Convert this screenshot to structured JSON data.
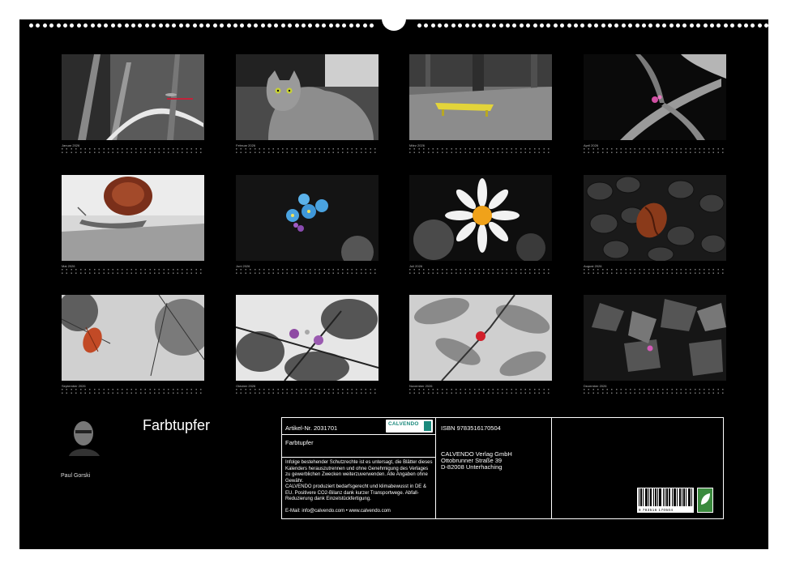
{
  "calendar": {
    "title": "Farbtupfer",
    "author": "Paul Gorski"
  },
  "months": [
    {
      "label": "Januar",
      "year": "2026",
      "icon": "dragonfly-photo"
    },
    {
      "label": "Februar",
      "year": "2026",
      "icon": "cat-photo"
    },
    {
      "label": "März",
      "year": "2026",
      "icon": "yellow-bench-photo"
    },
    {
      "label": "April",
      "year": "2026",
      "icon": "pink-flower-photo"
    },
    {
      "label": "Mai",
      "year": "2026",
      "icon": "snail-photo"
    },
    {
      "label": "Juni",
      "year": "2026",
      "icon": "forget-me-not-photo"
    },
    {
      "label": "Juli",
      "year": "2026",
      "icon": "daisy-photo"
    },
    {
      "label": "August",
      "year": "2026",
      "icon": "coffee-beans-photo"
    },
    {
      "label": "September",
      "year": "2026",
      "icon": "pine-cone-photo"
    },
    {
      "label": "Oktober",
      "year": "2026",
      "icon": "plums-photo"
    },
    {
      "label": "November",
      "year": "2026",
      "icon": "red-berry-photo"
    },
    {
      "label": "Dezember",
      "year": "2026",
      "icon": "ivy-photo"
    }
  ],
  "info": {
    "article": "Artikel-Nr. 2031701",
    "product_title": "Farbtupfer",
    "legal1": "Infolge bestehender Schutzrechte ist es untersagt, die Blätter dieses Kalenders herauszutrennen und ohne Genehmigung des Verlages zu gewerblichen Zwecken weiterzuverwenden. Alle Angaben ohne Gewähr.",
    "legal2": "CALVENDO produziert bedarfsgerecht und klimabewusst in DE & EU. Positivere CO2-Bilanz dank kurzer Transportwege. Abfall-Reduzierung dank Einzelstückfertigung.",
    "contact": "E-Mail: info@calvendo.com • www.calvendo.com",
    "isbn": "ISBN 9783516170504",
    "publisher_name": "CALVENDO Verlag GmbH",
    "publisher_street": "Ottobrunner Straße 39",
    "publisher_city": "D-82008 Unterhaching",
    "logo_text": "CALVENDO",
    "barcode_digits": "9 783516 170504"
  },
  "colors": {
    "background": "#000000",
    "sheet_border": "#ffffff",
    "calvendo_green": "#1b8a7d",
    "eco_green": "#3b8a3e"
  }
}
